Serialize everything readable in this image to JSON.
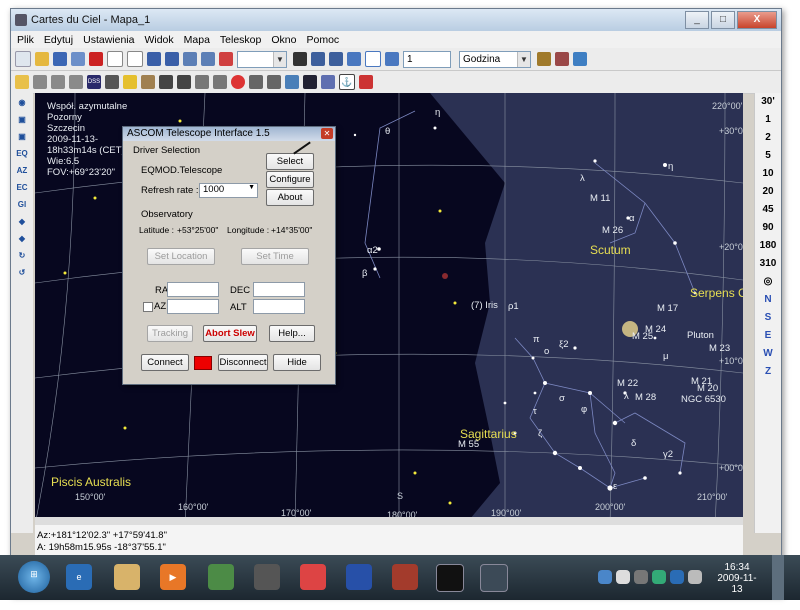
{
  "window": {
    "title": "Cartes du Ciel - Mapa_1",
    "btn_min": "_",
    "btn_max": "□",
    "btn_close": "X"
  },
  "menu": [
    "Plik",
    "Edytuj",
    "Ustawienia",
    "Widok",
    "Mapa",
    "Teleskop",
    "Okno",
    "Pomoc"
  ],
  "toolbar": {
    "step_value": "1",
    "time_unit": "Godzina"
  },
  "scale": [
    "30'",
    "1",
    "2",
    "5",
    "10",
    "20",
    "45",
    "90",
    "180",
    "310"
  ],
  "directions": [
    "N",
    "S",
    "E",
    "W",
    "Z"
  ],
  "map_info": [
    "Współ. azymutalne",
    "Pozorny",
    "Szczecin",
    "2009-11-13-",
    "18h33m14s (CET)",
    "Wie:6.5",
    "FOV:+69°23'20\""
  ],
  "constellations": [
    "Scutum",
    "Serpens Ca",
    "Sagittarius",
    "Piscis Australis"
  ],
  "objects": [
    "M 11",
    "M 26",
    "M 17",
    "M 24",
    "M 25",
    "M 23",
    "M 22",
    "M 21",
    "M 20",
    "M 28",
    "NGC 6530",
    "M 55",
    "Pluton",
    "(7) Iris"
  ],
  "greek": [
    "η",
    "θ",
    "α2",
    "β",
    "λ",
    "α",
    "η",
    "ρ1",
    "π",
    "ξ2",
    "σ",
    "τ",
    "ζ",
    "φ",
    "λ",
    "μ",
    "δ",
    "γ2",
    "ε",
    "ο"
  ],
  "ra_ticks": [
    "150°00'",
    "160°00'",
    "170°00'",
    "180°00'",
    "190°00'",
    "200°00'",
    "210°00'",
    "S"
  ],
  "dec_ticks": [
    "220°00'",
    "+30°00'",
    "+20°00'",
    "+10°00'",
    "+00°00'"
  ],
  "dialog": {
    "title": "ASCOM Telescope Interface 1.5",
    "driver_group": "Driver Selection",
    "driver": "EQMOD.Telescope",
    "select": "Select",
    "configure": "Configure",
    "about": "About",
    "refresh_label": "Refresh rate :",
    "refresh_value": "1000",
    "observatory_group": "Observatory",
    "latitude_label": "Latitude :",
    "latitude_value": "+53°25'00\"",
    "longitude_label": "Longitude :",
    "longitude_value": "+14°35'00\"",
    "set_location": "Set Location",
    "set_time": "Set Time",
    "ra_label": "RA",
    "dec_label": "DEC",
    "az_label": "AZ",
    "alt_label": "ALT",
    "tracking": "Tracking",
    "abort_slew": "Abort Slew",
    "help": "Help...",
    "connect": "Connect",
    "disconnect": "Disconnect",
    "hide": "Hide"
  },
  "status": {
    "line1": "Az:+181°12'02.3\" +17°59'41.8\"",
    "line2": "A: 19h58m15.95s -18°37'55.1\""
  },
  "clock": {
    "time": "16:34",
    "date": "2009-11-13"
  }
}
